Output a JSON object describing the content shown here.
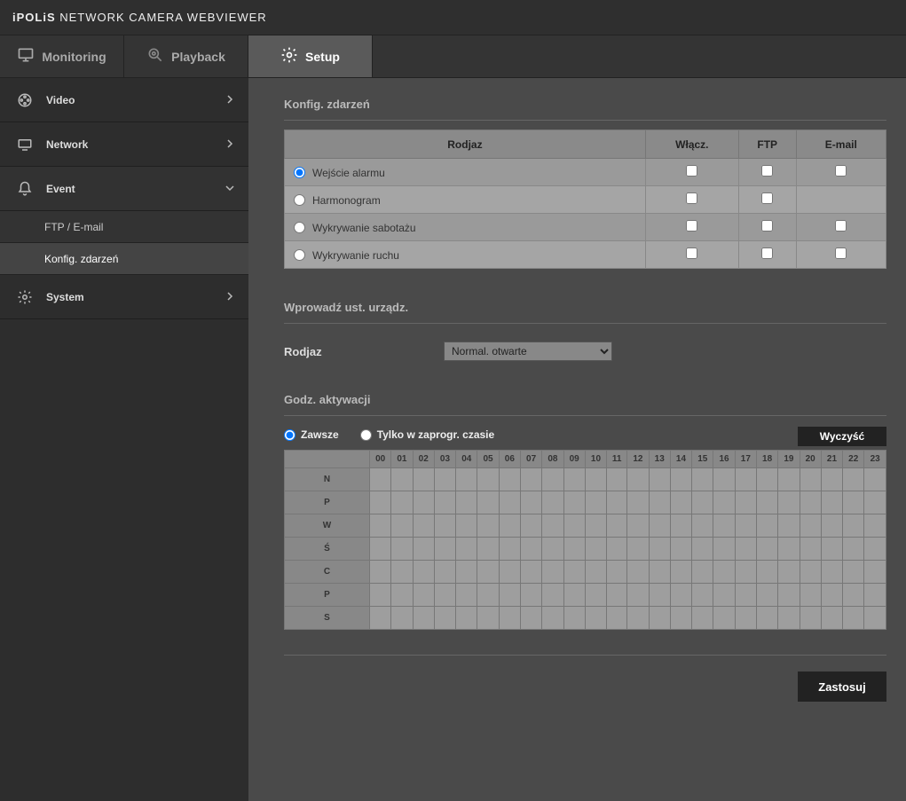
{
  "brand_prefix": "iPOLiS",
  "brand_rest": " NETWORK CAMERA WEBVIEWER",
  "tabs": {
    "monitoring": "Monitoring",
    "playback": "Playback",
    "setup": "Setup"
  },
  "sidebar": {
    "video": "Video",
    "network": "Network",
    "event": "Event",
    "event_sub": {
      "ftp": "FTP / E-mail",
      "konfig": "Konfig. zdarzeń"
    },
    "system": "System"
  },
  "sections": {
    "konfig": "Konfig. zdarzeń",
    "wprowadz": "Wprowadź ust. urządz.",
    "godz": "Godz. aktywacji"
  },
  "evt_headers": {
    "rodjaz": "Rodjaz",
    "wlacz": "Włącz.",
    "ftp": "FTP",
    "email": "E-mail"
  },
  "evt_rows": [
    {
      "name": "Wejście alarmu",
      "selected": true,
      "email_hidden": false
    },
    {
      "name": "Harmonogram",
      "selected": false,
      "email_hidden": true
    },
    {
      "name": "Wykrywanie sabotażu",
      "selected": false,
      "email_hidden": false
    },
    {
      "name": "Wykrywanie ruchu",
      "selected": false,
      "email_hidden": false
    }
  ],
  "type_label": "Rodjaz",
  "type_options": [
    "Normal. otwarte"
  ],
  "type_value": "Normal. otwarte",
  "act": {
    "zawsze": "Zawsze",
    "tylko": "Tylko w zaprogr. czasie",
    "selected": "zawsze"
  },
  "clear_btn": "Wyczyść",
  "hours": [
    "00",
    "01",
    "02",
    "03",
    "04",
    "05",
    "06",
    "07",
    "08",
    "09",
    "10",
    "11",
    "12",
    "13",
    "14",
    "15",
    "16",
    "17",
    "18",
    "19",
    "20",
    "21",
    "22",
    "23"
  ],
  "days": [
    "N",
    "P",
    "W",
    "Ś",
    "C",
    "P",
    "S"
  ],
  "apply_btn": "Zastosuj"
}
